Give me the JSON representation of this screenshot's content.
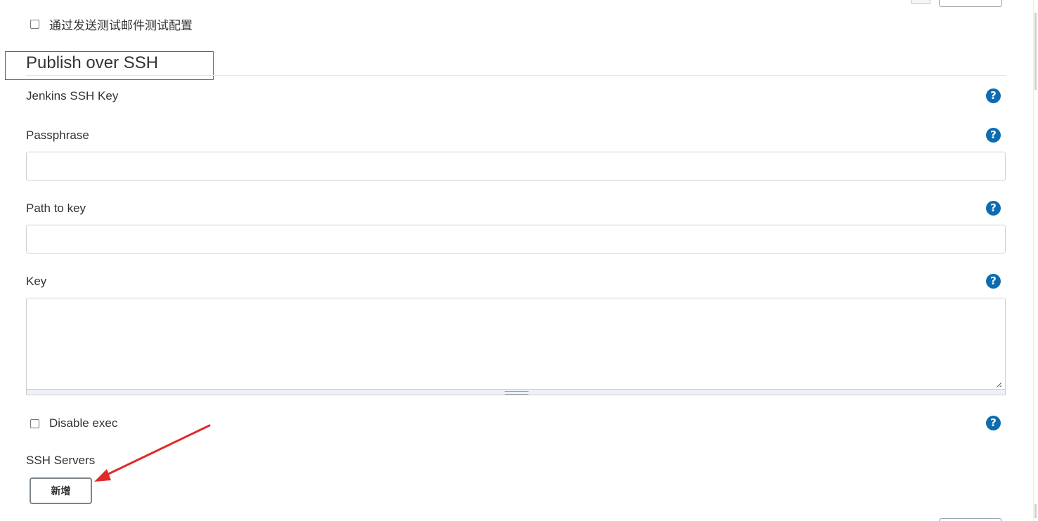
{
  "email_test": {
    "checkbox_label": "通过发送测试邮件测试配置",
    "checked": false
  },
  "section": {
    "title": "Publish over SSH"
  },
  "fields": {
    "jenkins_ssh_key_label": "Jenkins SSH Key",
    "passphrase_label": "Passphrase",
    "passphrase_value": "",
    "path_to_key_label": "Path to key",
    "path_to_key_value": "",
    "key_label": "Key",
    "key_value": ""
  },
  "disable_exec": {
    "label": "Disable exec",
    "checked": false
  },
  "ssh_servers": {
    "label": "SSH Servers",
    "add_button_label": "新增"
  },
  "help": {
    "glyph": "?"
  },
  "colors": {
    "help_icon": "#0d6cb0",
    "annotation_red": "#d9282f"
  }
}
